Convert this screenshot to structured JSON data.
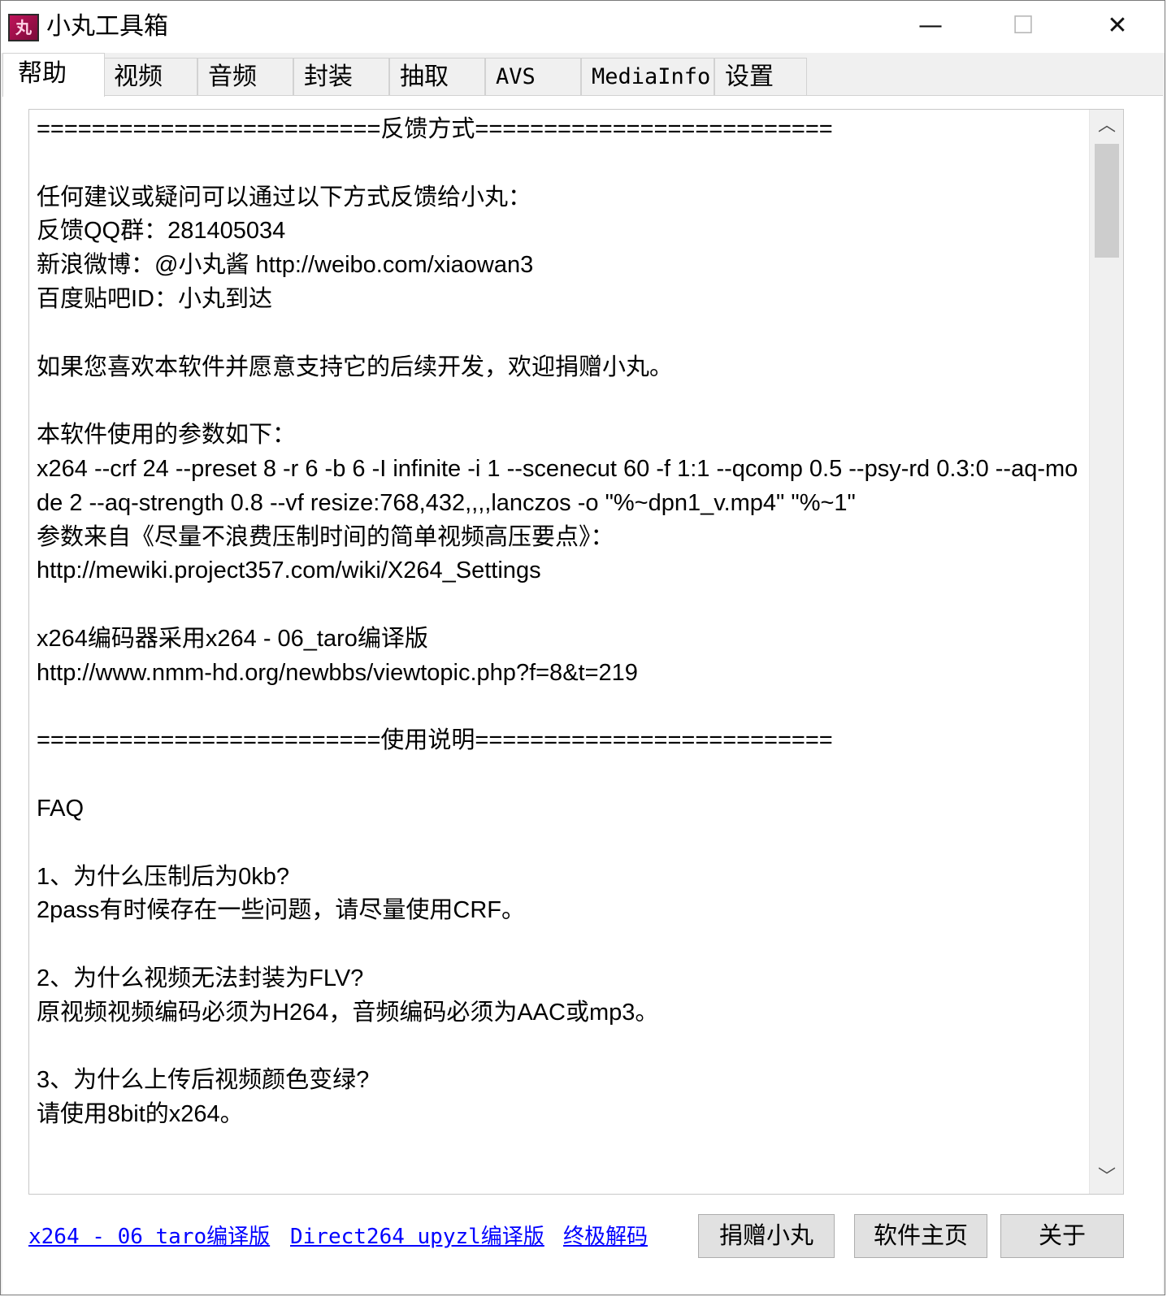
{
  "window": {
    "title": "小丸工具箱",
    "icon_glyph": "丸",
    "controls": {
      "minimize": "—",
      "maximize": "☐",
      "close": "✕"
    }
  },
  "tabs": [
    {
      "label": "帮助",
      "active": true
    },
    {
      "label": "视频",
      "active": false
    },
    {
      "label": "音频",
      "active": false
    },
    {
      "label": "封装",
      "active": false
    },
    {
      "label": "抽取",
      "active": false
    },
    {
      "label": "AVS",
      "active": false
    },
    {
      "label": "MediaInfo",
      "active": false
    },
    {
      "label": "设置",
      "active": false
    }
  ],
  "help": {
    "text": "=========================反馈方式==========================\n\n任何建议或疑问可以通过以下方式反馈给小丸：\n反馈QQ群：281405034\n新浪微博：@小丸酱 http://weibo.com/xiaowan3\n百度贴吧ID：小丸到达\n\n如果您喜欢本软件并愿意支持它的后续开发，欢迎捐赠小丸。\n\n本软件使用的参数如下：\nx264 --crf 24 --preset 8 -r 6 -b 6 -I infinite -i 1 --scenecut 60 -f 1:1 --qcomp 0.5 --psy-rd 0.3:0 --aq-mode 2 --aq-strength 0.8 --vf resize:768,432,,,,lanczos -o \"%~dpn1_v.mp4\" \"%~1\"\n参数来自《尽量不浪费压制时间的简单视频高压要点》：\nhttp://mewiki.project357.com/wiki/X264_Settings\n\nx264编码器采用x264 - 06_taro编译版\nhttp://www.nmm-hd.org/newbbs/viewtopic.php?f=8&t=219\n\n=========================使用说明==========================\n\nFAQ\n\n1、为什么压制后为0kb?\n2pass有时候存在一些问题，请尽量使用CRF。\n\n2、为什么视频无法封装为FLV?\n原视频视频编码必须为H264，音频编码必须为AAC或mp3。\n\n3、为什么上传后视频颜色变绿?\n请使用8bit的x264。"
  },
  "scrollbar": {
    "up_icon": "︿",
    "down_icon": "﹀"
  },
  "footer": {
    "links": [
      "x264 - 06 taro编译版",
      "Direct264 upyzl编译版",
      "终极解码"
    ],
    "buttons": {
      "donate": "捐赠小丸",
      "homepage": "软件主页",
      "about": "关于"
    }
  }
}
